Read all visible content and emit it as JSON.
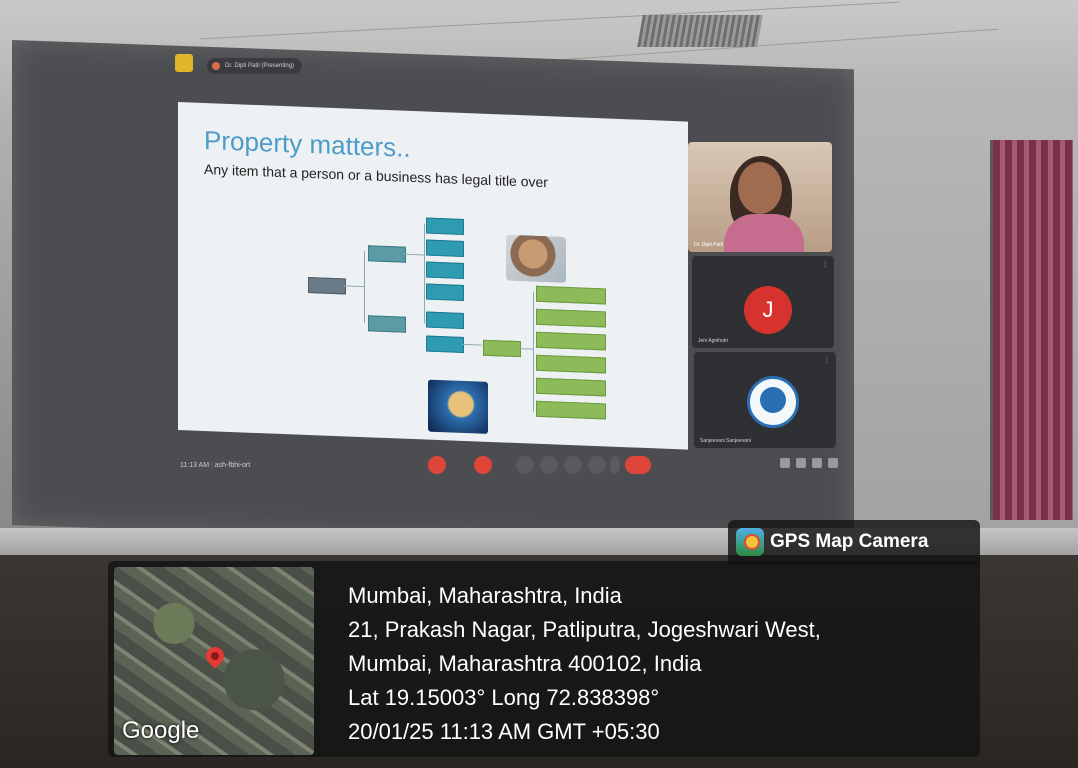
{
  "meeting": {
    "presenter_label": "Dr. Dipti Patil (Presenting)",
    "time": "11:13 AM",
    "meeting_code": "ash-fbhi-ort"
  },
  "slide": {
    "title": "Property matters..",
    "subtitle": "Any item that a person or a business has legal title over"
  },
  "participants": [
    {
      "name": "Dr. Dipti Patil"
    },
    {
      "name": "Jeni Agnihotri",
      "initial": "J"
    },
    {
      "name": "Sanjeevani Sanjeevani"
    }
  ],
  "overlay": {
    "brand": "GPS Map Camera",
    "map_label": "Google",
    "lines": [
      "Mumbai, Maharashtra, India",
      "21, Prakash Nagar, Patliputra, Jogeshwari West,",
      "Mumbai, Maharashtra 400102, India",
      "Lat 19.15003° Long 72.838398°",
      "20/01/25 11:13 AM GMT +05:30"
    ]
  },
  "icons": [
    "app-icon",
    "mic-icon",
    "camera-icon",
    "captions-icon",
    "emoji-icon",
    "present-icon",
    "hand-icon",
    "more-icon",
    "end-call-icon",
    "info-icon",
    "people-icon",
    "chat-icon",
    "activities-icon",
    "gps-camera-icon",
    "map-pin-icon"
  ],
  "colors": {
    "slide_title": "#4d9cc7",
    "end_call": "#e0453a",
    "avatar": "#d6332e"
  }
}
